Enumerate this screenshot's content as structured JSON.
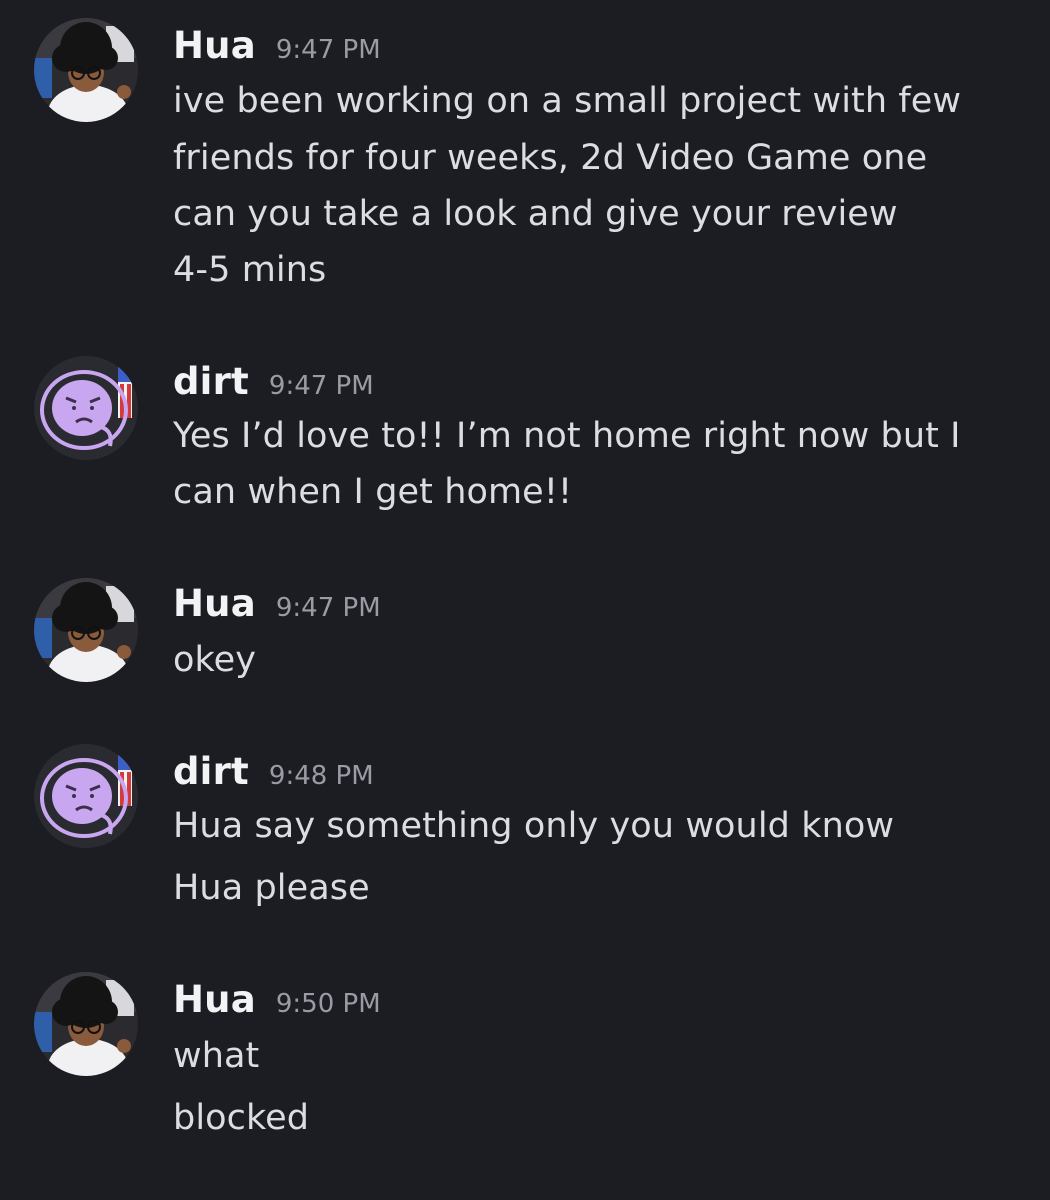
{
  "messages": [
    {
      "user": "Hua",
      "avatar_icon": "photo-avatar-icon",
      "time": "9:47 PM",
      "lines": [
        "ive been working on a small project with few",
        "friends for four weeks, 2d Video Game one",
        "can you take a look and give your review",
        "4-5 mins"
      ]
    },
    {
      "user": "dirt",
      "avatar_icon": "purple-face-avatar-icon",
      "time": "9:47 PM",
      "lines": [
        "Yes I’d love to!! I’m not home right now but I",
        "can when I get home!!"
      ]
    },
    {
      "user": "Hua",
      "avatar_icon": "photo-avatar-icon",
      "time": "9:47 PM",
      "lines": [
        "okey"
      ]
    },
    {
      "user": "dirt",
      "avatar_icon": "purple-face-avatar-icon",
      "time": "9:48 PM",
      "lines": [
        "Hua say something only you would know",
        "Hua please"
      ]
    },
    {
      "user": "Hua",
      "avatar_icon": "photo-avatar-icon",
      "time": "9:50 PM",
      "lines": [
        "what",
        "blocked"
      ]
    }
  ],
  "colors": {
    "background": "#1c1d22",
    "username": "#f2f3f5",
    "timestamp": "#9a9ca5",
    "text": "#dcdde2",
    "dirt_avatar_purple": "#c9a6f0"
  }
}
